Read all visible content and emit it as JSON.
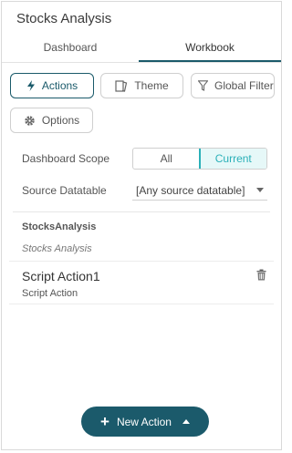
{
  "panel": {
    "title": "Stocks Analysis"
  },
  "tabs": [
    {
      "label": "Dashboard",
      "active": false
    },
    {
      "label": "Workbook",
      "active": true
    }
  ],
  "toolbar": {
    "actions": {
      "label": "Actions",
      "icon": "lightning-icon",
      "active": true
    },
    "theme": {
      "label": "Theme",
      "icon": "theme-book-icon"
    },
    "global_filter": {
      "label": "Global Filter",
      "icon": "filter-icon"
    },
    "options": {
      "label": "Options",
      "icon": "gear-icon"
    }
  },
  "dashboard_scope": {
    "label": "Dashboard Scope",
    "options": [
      "All",
      "Current"
    ],
    "selected": "Current"
  },
  "source_datatable": {
    "label": "Source Datatable",
    "value": "[Any source datatable]"
  },
  "group": {
    "title": "StocksAnalysis",
    "subtitle": "Stocks Analysis"
  },
  "actions_list": [
    {
      "name": "Script Action1",
      "type": "Script Action"
    }
  ],
  "new_action": {
    "label": "New Action"
  },
  "colors": {
    "accent": "#1b5a6b",
    "selected_segment": "#2ab0b8"
  }
}
